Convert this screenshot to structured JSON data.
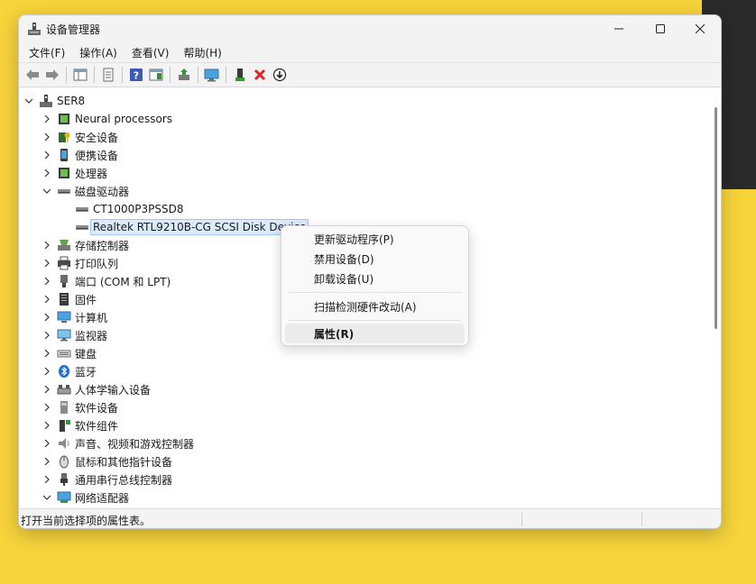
{
  "window": {
    "title": "设备管理器"
  },
  "menu": [
    "文件(F)",
    "操作(A)",
    "查看(V)",
    "帮助(H)"
  ],
  "tree": {
    "root": "SER8",
    "categories": [
      {
        "label": "Neural processors",
        "icon": "neural-processor-icon",
        "expanded": false
      },
      {
        "label": "安全设备",
        "icon": "security-device-icon",
        "expanded": false
      },
      {
        "label": "便携设备",
        "icon": "portable-device-icon",
        "expanded": false
      },
      {
        "label": "处理器",
        "icon": "processor-icon",
        "expanded": false
      },
      {
        "label": "磁盘驱动器",
        "icon": "disk-drive-icon",
        "expanded": true,
        "children": [
          "CT1000P3PSSD8",
          "Realtek RTL9210B-CG SCSI Disk Device"
        ]
      },
      {
        "label": "存储控制器",
        "icon": "storage-controller-icon",
        "expanded": false
      },
      {
        "label": "打印队列",
        "icon": "printer-icon",
        "expanded": false
      },
      {
        "label": "端口 (COM 和 LPT)",
        "icon": "port-icon",
        "expanded": false
      },
      {
        "label": "固件",
        "icon": "firmware-icon",
        "expanded": false
      },
      {
        "label": "计算机",
        "icon": "computer-icon",
        "expanded": false
      },
      {
        "label": "监视器",
        "icon": "monitor-icon",
        "expanded": false
      },
      {
        "label": "键盘",
        "icon": "keyboard-icon",
        "expanded": false
      },
      {
        "label": "蓝牙",
        "icon": "bluetooth-icon",
        "expanded": false
      },
      {
        "label": "人体学输入设备",
        "icon": "hid-icon",
        "expanded": false
      },
      {
        "label": "软件设备",
        "icon": "software-device-icon",
        "expanded": false
      },
      {
        "label": "软件组件",
        "icon": "software-component-icon",
        "expanded": false
      },
      {
        "label": "声音、视频和游戏控制器",
        "icon": "sound-icon",
        "expanded": false
      },
      {
        "label": "鼠标和其他指针设备",
        "icon": "mouse-icon",
        "expanded": false
      },
      {
        "label": "通用串行总线控制器",
        "icon": "usb-icon",
        "expanded": false
      },
      {
        "label": "网络适配器",
        "icon": "network-adapter-icon",
        "expanded": true
      }
    ]
  },
  "context_menu": {
    "items": [
      "更新驱动程序(P)",
      "禁用设备(D)",
      "卸载设备(U)",
      "扫描检测硬件改动(A)",
      "属性(R)"
    ]
  },
  "status": {
    "text": "打开当前选择项的属性表。"
  },
  "colors": {
    "background": "#f7d43c",
    "selection": "#dcebfc",
    "delete_icon": "#d9262c"
  }
}
